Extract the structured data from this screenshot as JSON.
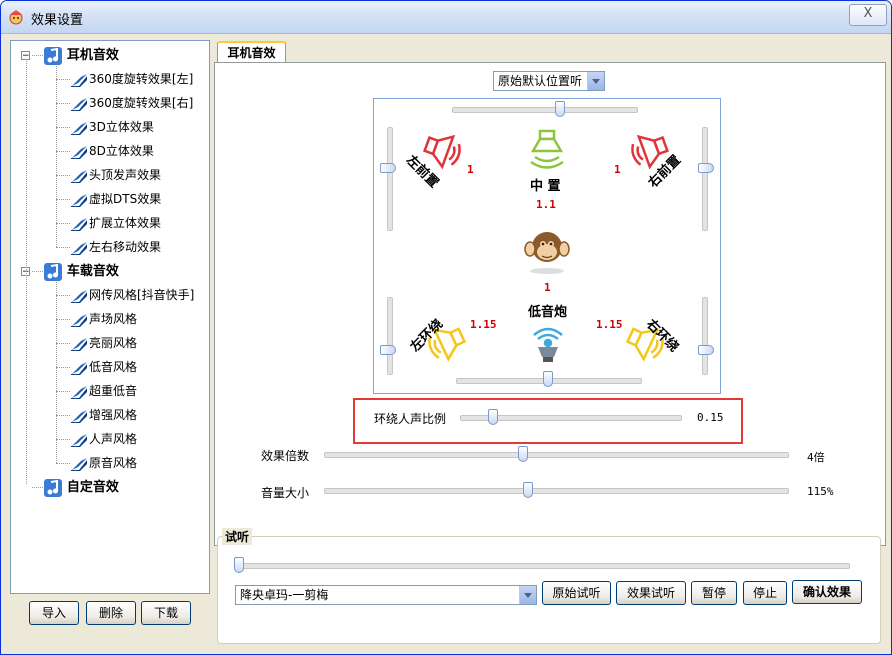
{
  "window": {
    "title": "效果设置",
    "close_label": "X"
  },
  "tree": {
    "groups": [
      {
        "label": "耳机音效",
        "items": [
          "360度旋转效果[左]",
          "360度旋转效果[右]",
          "3D立体效果",
          "8D立体效果",
          "头顶发声效果",
          "虚拟DTS效果",
          "扩展立体效果",
          "左右移动效果"
        ]
      },
      {
        "label": "车载音效",
        "items": [
          "网传风格[抖音快手]",
          "声场风格",
          "亮丽风格",
          "低音风格",
          "超重低音",
          "增强风格",
          "人声风格",
          "原音风格"
        ]
      },
      {
        "label": "自定音效",
        "items": []
      }
    ]
  },
  "buttons": {
    "import": "导入",
    "delete": "删除",
    "download": "下载"
  },
  "tab": {
    "label": "耳机音效"
  },
  "position_preset": {
    "value": "原始默认位置听"
  },
  "speakers": {
    "front_left": {
      "label": "左前置",
      "value": "1"
    },
    "center": {
      "label": "中 置",
      "value": "1.1"
    },
    "front_right": {
      "label": "右前置",
      "value": "1"
    },
    "listener_value": "1",
    "surround_left": {
      "label": "左环绕",
      "value": "1.15"
    },
    "subwoofer": {
      "label": "低音炮"
    },
    "surround_right": {
      "label": "右环绕",
      "value": "1.15"
    }
  },
  "surround_vocal": {
    "label": "环绕人声比例",
    "value": "0.15",
    "level": 0.15
  },
  "effect_multiplier": {
    "label": "效果倍数",
    "value": "4倍",
    "level": 0.43
  },
  "volume": {
    "label": "音量大小",
    "value": "115%",
    "level": 0.44
  },
  "preview": {
    "title": "试听",
    "progress": 0,
    "song": "降央卓玛-一剪梅",
    "original_btn": "原始试听",
    "effect_btn": "效果试听",
    "pause_btn": "暂停",
    "stop_btn": "停止",
    "confirm_btn": "确认效果"
  },
  "colors": {
    "accent_red": "#d10000",
    "highlight_red": "#e53935",
    "speaker_red": "#e0333a",
    "speaker_green": "#8cc63f",
    "speaker_yellow": "#f5c518",
    "speaker_blue": "#3fa9dc"
  }
}
